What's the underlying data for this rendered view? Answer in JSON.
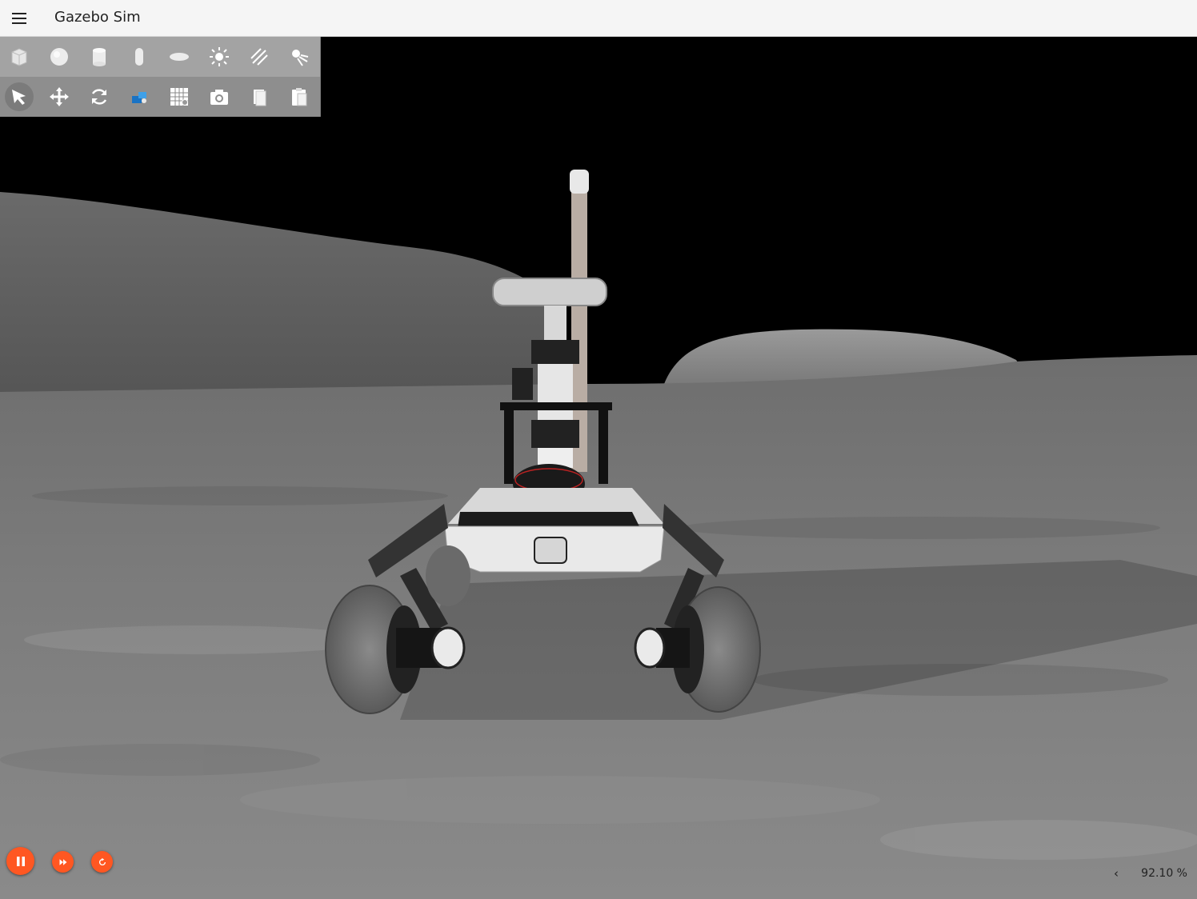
{
  "app": {
    "title": "Gazebo Sim"
  },
  "toolbar": {
    "shapes": [
      {
        "icon": "box-icon",
        "name": "Box"
      },
      {
        "icon": "sphere-icon",
        "name": "Sphere"
      },
      {
        "icon": "cylinder-icon",
        "name": "Cylinder"
      },
      {
        "icon": "capsule-icon",
        "name": "Capsule"
      },
      {
        "icon": "ellipsoid-icon",
        "name": "Ellipsoid"
      },
      {
        "icon": "point-light-icon",
        "name": "Point light"
      },
      {
        "icon": "directional-light-icon",
        "name": "Directional light"
      },
      {
        "icon": "spot-light-icon",
        "name": "Spot light"
      }
    ],
    "tools": [
      {
        "icon": "select-arrow-icon",
        "name": "Select",
        "selected": true
      },
      {
        "icon": "translate-icon",
        "name": "Translate"
      },
      {
        "icon": "rotate-icon",
        "name": "Rotate"
      },
      {
        "icon": "transform-control-icon",
        "name": "Transform control"
      },
      {
        "icon": "grid-config-icon",
        "name": "Grid config"
      },
      {
        "icon": "screenshot-camera-icon",
        "name": "Screenshot"
      },
      {
        "icon": "copy-icon",
        "name": "Copy"
      },
      {
        "icon": "paste-icon",
        "name": "Paste"
      }
    ]
  },
  "playback": {
    "pause": "pause-icon",
    "step": "step-icon",
    "reset": "reset-icon",
    "accent": "#ff5722"
  },
  "status": {
    "collapse": "‹",
    "real_time_factor": "92.10 %"
  },
  "colors": {
    "sky": "#000000",
    "terrain": "#8a8a8a",
    "toolbar": "#a3a3a3"
  }
}
